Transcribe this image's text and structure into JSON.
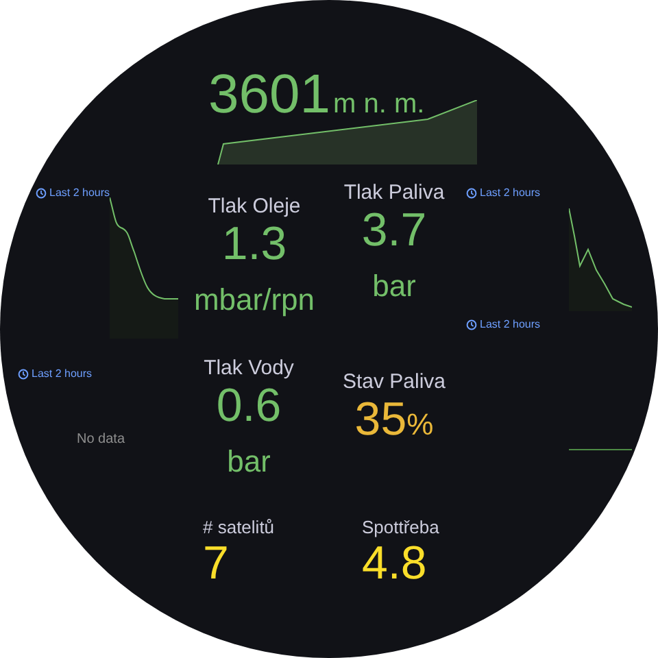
{
  "altitude": {
    "value": "3601",
    "unit": "m n. m."
  },
  "time_ranges": [
    {
      "label": "Last 2 hours"
    },
    {
      "label": "Last 2 hours"
    },
    {
      "label": "Last 2 hours"
    },
    {
      "label": "Last 2 hours"
    }
  ],
  "no_data": "No data",
  "stats": [
    {
      "kind": "below",
      "title": "Tlak Oleje",
      "value": "1.3",
      "unit": "mbar/rpn",
      "color": "#73bf69"
    },
    {
      "kind": "below",
      "title": "Tlak Paliva",
      "value": "3.7",
      "unit": "bar",
      "color": "#73bf69"
    },
    {
      "kind": "below",
      "title": "Tlak Vody",
      "value": "0.6",
      "unit": "bar",
      "color": "#73bf69"
    },
    {
      "kind": "inline",
      "title": "Stav Paliva",
      "value": "35",
      "unit": "%",
      "color": "#eab839"
    },
    {
      "kind": "plain",
      "title": "# satelitů",
      "value": "7",
      "color": "#fade2a"
    },
    {
      "kind": "plain",
      "title": "Spottřeba",
      "value": "4.8",
      "color": "#fade2a"
    }
  ]
}
